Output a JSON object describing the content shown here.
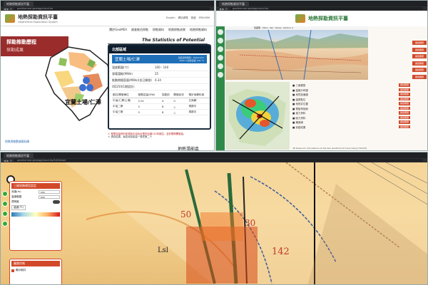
{
  "win1": {
    "tab_title": "地熱探勘資訊平臺",
    "url": "geothermal.geologycloud.tw",
    "logo_zh": "地熱探勘資訊平臺",
    "logo_en": "Geothermal Exploration System",
    "top_links": [
      "English",
      "網站導覽",
      "旅遊",
      "EPAGISM"
    ],
    "nav": [
      "關於GeoMEX",
      "調查推估探勘",
      "探勘資料",
      "地熱探勘成果",
      "地熱探勘資料"
    ],
    "side_title": "探勘推動歷程",
    "side_sub": "探勘成果",
    "stats_title": "The Statistics of Potential Area",
    "region": "北部區域",
    "site_name": "宜蘭土場/仁澤",
    "site_note_1": "溫度資料時間：2020/12/1",
    "site_note_2": "1000 m深的溫度 100 °C",
    "map_label": "宜蘭土場/仁澤",
    "kv": [
      {
        "k": "溫度範圍(℃)",
        "v": "100 - 140"
      },
      {
        "k": "發電潛能(MWe)",
        "v": "25"
      },
      {
        "k": "推動期間容量(MWe)(含已開發)",
        "v": "0.24"
      },
      {
        "k": "OD250(1期設計)",
        "v": ""
      }
    ],
    "table_headers": [
      "鑽井/開發單位",
      "發電容量(MW)",
      "探勘前",
      "開發狀況",
      "預計商轉年度"
    ],
    "table_rows": [
      [
        "中油(仁澤/土場)",
        "0.24",
        "A",
        "O",
        "已商轉"
      ],
      [
        "中油二期",
        "5",
        "B",
        "△",
        "規劃中"
      ],
      [
        "中油三期",
        "5",
        "B",
        "△",
        "規劃中"
      ]
    ],
    "notes": [
      "＊ 發電容量資料來源為中油及台電於民國110年推估，並非實際開發量。",
      "＊ 調查結果，每區域探勘量一覽表第二十"
    ],
    "footer_link": "地熱探勘數據資料庫",
    "bottom_label": "地熱潛能區"
  },
  "win2": {
    "tab_title": "地熱探勘資訊平臺",
    "url": "geothermal.geologycloud.tw",
    "logo_zh": "地熱探勘資訊平臺",
    "section_title": "剖面圖 · Tatun, Ilan, Yanlan, Section A",
    "buttons": [
      "開啟圖層",
      "開啟圖層",
      "開啟圖層",
      "開啟圖層",
      "開啟圖層",
      "開啟圖層",
      "開啟圖層",
      "開啟圖層",
      "開啟圖層",
      "開啟圖層"
    ],
    "list": [
      {
        "label": "■ 三維模型",
        "btn": "開啟圖層"
      },
      {
        "label": "■ 溫度分布圖",
        "btn": "開啟圖層"
      },
      {
        "label": "■ 地質剖面圖",
        "btn": "開啟圖層"
      },
      {
        "label": "■ 溫泉點位",
        "btn": "開啟圖層"
      },
      {
        "label": "■ 地熱井位置",
        "btn": "開啟圖層"
      },
      {
        "label": "■ 電阻率剖面",
        "btn": "開啟圖層"
      },
      {
        "label": "■ 重力資料",
        "btn": "開啟圖層"
      },
      {
        "label": "■ 磁力資料",
        "btn": "開啟圖層"
      },
      {
        "label": "■ 構造線",
        "btn": "開啟圖層"
      },
      {
        "label": "■ 探勘成果",
        "btn": "開啟圖層"
      }
    ],
    "caption": "3D Reservoir Simulations at the Ilan Geothermal Area (Using TOUGH)"
  },
  "win3": {
    "tab_title": "地熱探勘資訊平臺",
    "url": "geothermal.geologycloud.tw/3d/Viewer",
    "panel_title": "三維地熱模型設定",
    "fields": [
      {
        "label": "深度(m)",
        "value": "-500"
      },
      {
        "label": "溫度範圍",
        "value": "-600"
      }
    ],
    "toggle_label": "透明度",
    "select_label": "溫度(℃)",
    "panel2_title": "圖層控制",
    "panel2_item": "顯示鑽井",
    "labels_3d": [
      "50",
      "30",
      "142",
      "Lsl"
    ]
  },
  "colors": {
    "accent": "#d2492a",
    "dark_red": "#9b2c2c",
    "navy": "#0d1b2a",
    "blue": "#1e6fb8",
    "green": "#2f8a4a"
  }
}
